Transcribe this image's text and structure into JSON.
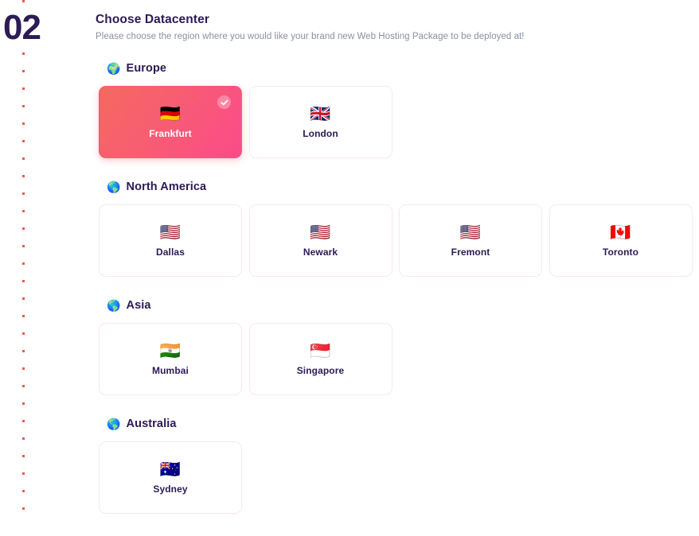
{
  "step": {
    "number": "02"
  },
  "header": {
    "title": "Choose Datacenter",
    "subtitle": "Please choose the region where you would like your brand new Web Hosting Package to be deployed at!"
  },
  "colors": {
    "accent_start": "#F4695E",
    "accent_end": "#FA4B8A",
    "heading": "#2B1A56",
    "subtitle": "#8A8FA3",
    "dot": "#F4574F",
    "card_border": "#F6E9EC",
    "background": "#FFFFFF"
  },
  "regions": [
    {
      "name": "Europe",
      "icon": "globe-europe-icon",
      "icon_glyph": "🌍",
      "datacenters": [
        {
          "city": "Frankfurt",
          "flag": "🇩🇪",
          "flag_name": "flag-germany-icon",
          "selected": true
        },
        {
          "city": "London",
          "flag": "🇬🇧",
          "flag_name": "flag-united-kingdom-icon",
          "selected": false
        }
      ]
    },
    {
      "name": "North America",
      "icon": "globe-americas-icon",
      "icon_glyph": "🌎",
      "datacenters": [
        {
          "city": "Dallas",
          "flag": "🇺🇸",
          "flag_name": "flag-united-states-icon",
          "selected": false
        },
        {
          "city": "Newark",
          "flag": "🇺🇸",
          "flag_name": "flag-united-states-icon",
          "selected": false
        },
        {
          "city": "Fremont",
          "flag": "🇺🇸",
          "flag_name": "flag-united-states-icon",
          "selected": false
        },
        {
          "city": "Toronto",
          "flag": "🇨🇦",
          "flag_name": "flag-canada-icon",
          "selected": false
        }
      ]
    },
    {
      "name": "Asia",
      "icon": "globe-americas-icon",
      "icon_glyph": "🌎",
      "datacenters": [
        {
          "city": "Mumbai",
          "flag": "🇮🇳",
          "flag_name": "flag-india-icon",
          "selected": false
        },
        {
          "city": "Singapore",
          "flag": "🇸🇬",
          "flag_name": "flag-singapore-icon",
          "selected": false
        }
      ]
    },
    {
      "name": "Australia",
      "icon": "globe-americas-icon",
      "icon_glyph": "🌎",
      "datacenters": [
        {
          "city": "Sydney",
          "flag": "🇦🇺",
          "flag_name": "flag-australia-icon",
          "selected": false
        }
      ]
    }
  ]
}
